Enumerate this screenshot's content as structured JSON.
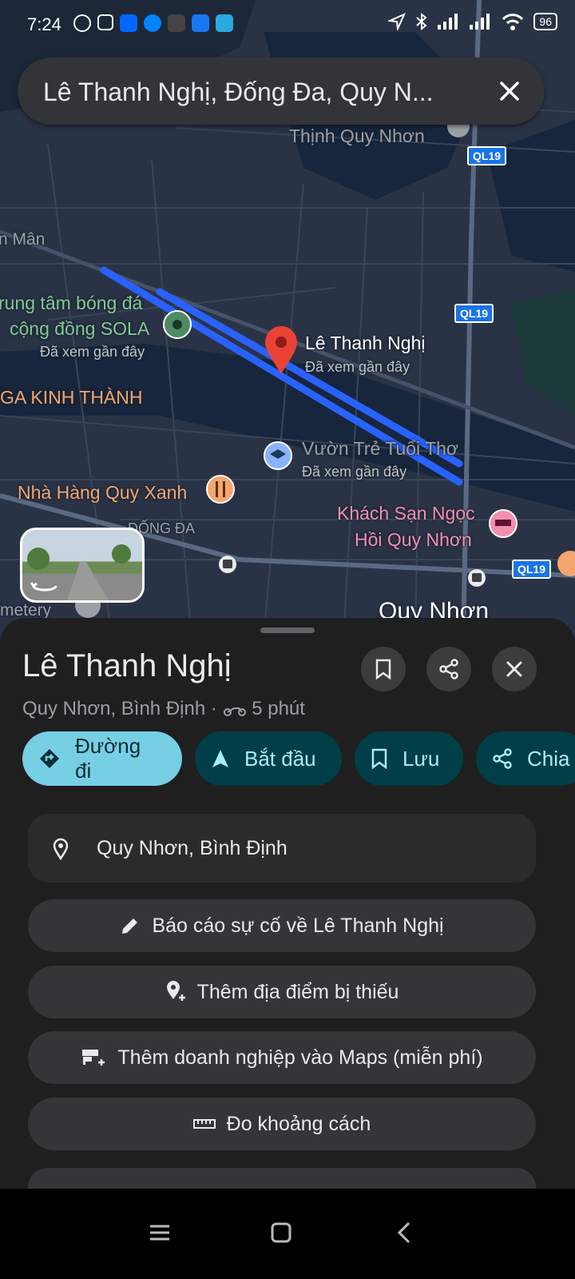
{
  "status_bar": {
    "time": "7:24",
    "battery": "96"
  },
  "search": {
    "query": "Lê Thanh Nghị, Đống Đa, Quy N..."
  },
  "map": {
    "labels": {
      "thinh_quy_nhon": "Thịnh Quy Nhơn",
      "n_man": "n Mân",
      "sola_line1": "rung tâm bóng đá",
      "sola_line2": "cộng đồng SOLA",
      "sola_sub": "Đã xem gần đây",
      "pin_title": "Lê Thanh Nghị",
      "pin_sub": "Đã xem gần đây",
      "ga": "GA KINH THÀNH",
      "vuon_tre": "Vườn Trẻ Tuổi Thơ",
      "vuon_tre_sub": "Đã xem gần đây",
      "restaurant": "Nhà Hàng Quy Xanh",
      "hotel_line1": "Khách Sạn Ngọc",
      "hotel_line2": "Hồi Quy Nhơn",
      "dong_da": "ĐỐNG ĐA",
      "cemetery": "metery",
      "city": "Quy Nhơn"
    },
    "shields": [
      "QL19",
      "QL19",
      "QL19"
    ],
    "route_color": "#2962ff",
    "pin_color": "#ea4335"
  },
  "sheet": {
    "title": "Lê Thanh Nghị",
    "subtitle_place": "Quy Nhơn, Bình Định",
    "subtitle_time": "5 phút",
    "actions": [
      {
        "label": "Đường đi",
        "icon": "directions-icon"
      },
      {
        "label": "Bắt đầu",
        "icon": "navigate-icon"
      },
      {
        "label": "Lưu",
        "icon": "bookmark-icon"
      },
      {
        "label": "Chia",
        "icon": "share-icon"
      }
    ],
    "address": "Quy Nhơn, Bình Định",
    "list_actions": [
      {
        "label": "Báo cáo sự cố về Lê Thanh Nghị",
        "icon": "pencil-icon"
      },
      {
        "label": "Thêm địa điểm bị thiếu",
        "icon": "add-place-icon"
      },
      {
        "label": "Thêm doanh nghiệp vào Maps (miễn phí)",
        "icon": "add-business-icon"
      },
      {
        "label": "Đo khoảng cách",
        "icon": "ruler-icon"
      }
    ]
  }
}
